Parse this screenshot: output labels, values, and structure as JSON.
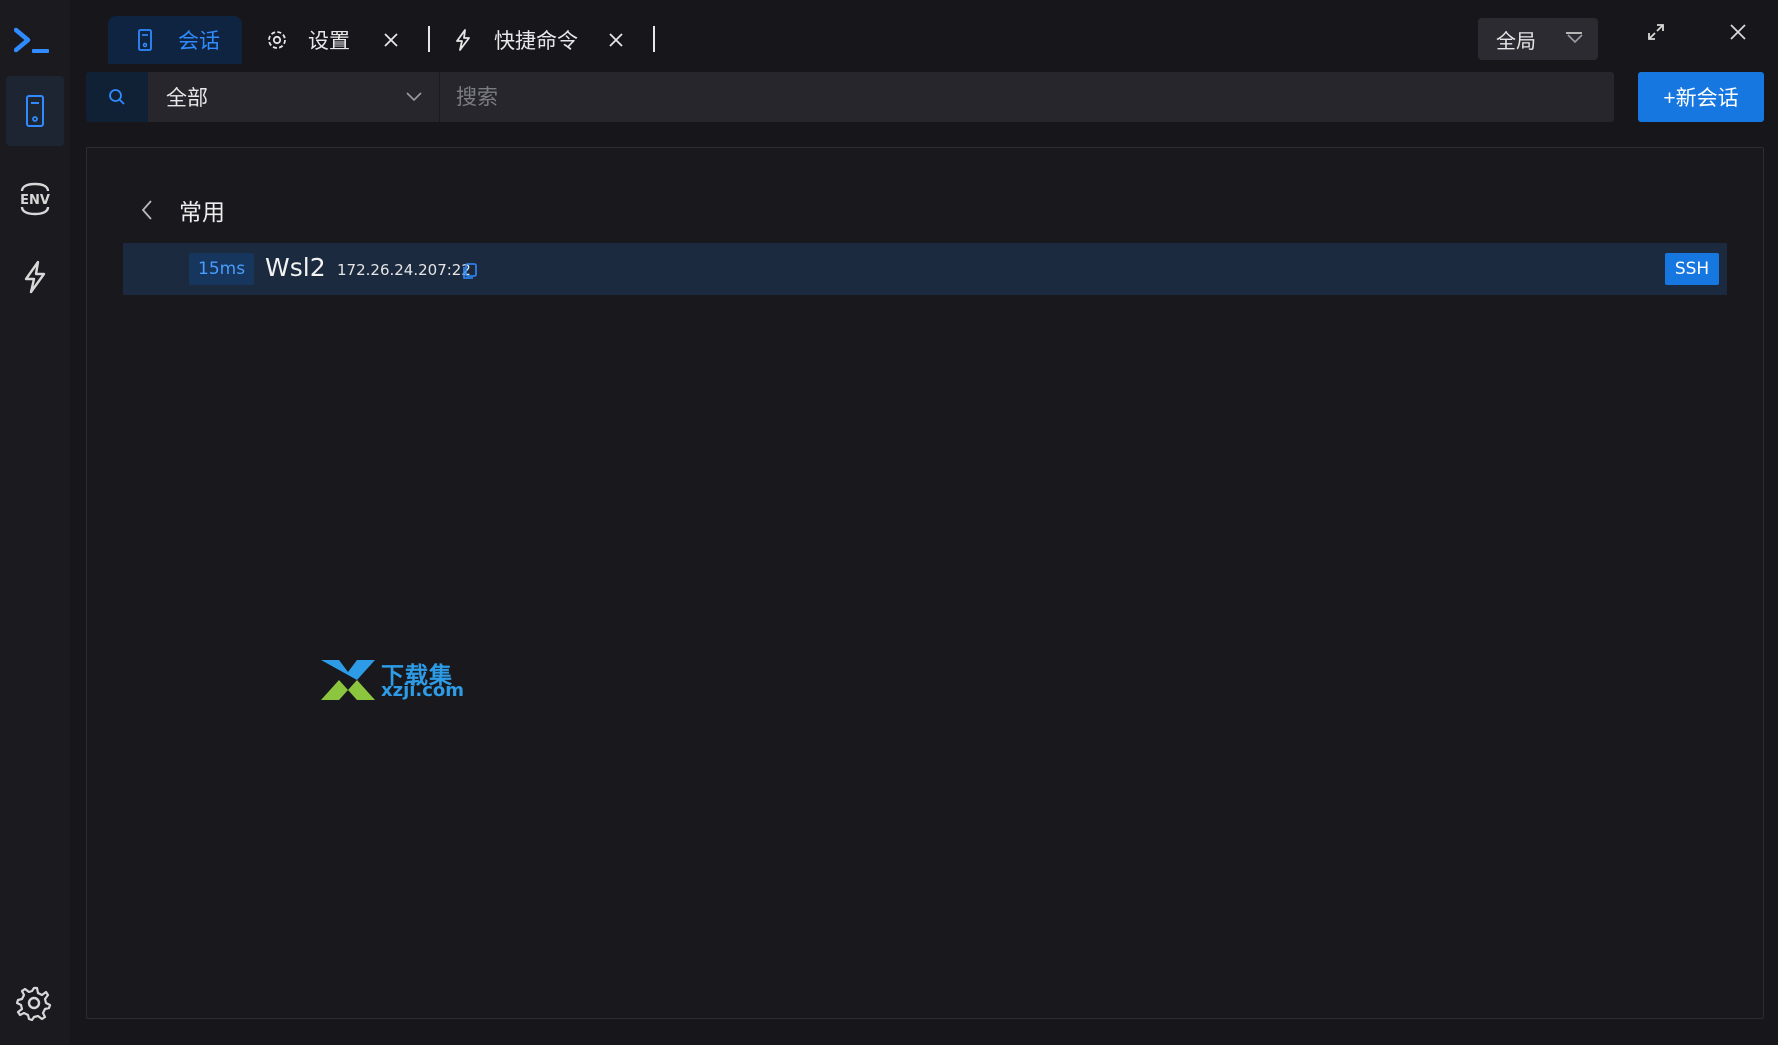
{
  "sidebar": {
    "items": [
      {
        "name": "sessions",
        "icon": "server-icon",
        "active": true
      },
      {
        "name": "env",
        "icon": "env-icon",
        "label": "ENV"
      },
      {
        "name": "quick-commands",
        "icon": "lightning-icon"
      }
    ],
    "settings_icon": "gear-icon"
  },
  "tabs": [
    {
      "label": "会话",
      "icon": "server-icon",
      "active": true
    },
    {
      "label": "设置",
      "icon": "gear-icon",
      "closable": true
    },
    {
      "label": "快捷命令",
      "icon": "lightning-icon",
      "closable": true
    }
  ],
  "scope_select": {
    "value": "全局"
  },
  "window_controls": [
    "minimize-icon",
    "restore-icon",
    "close-icon"
  ],
  "search": {
    "group_filter": "全部",
    "placeholder": "搜索",
    "value": ""
  },
  "new_session_button": "+新会话",
  "group": {
    "title": "常用"
  },
  "sessions": [
    {
      "latency": "15ms",
      "name": "Wsl2",
      "host": "172.26.24.207:22",
      "protocol": "SSH"
    }
  ],
  "watermark": {
    "cn": "下载集",
    "en": "xzji.com"
  },
  "colors": {
    "accent": "#1677e0",
    "accent_text": "#2f8bff",
    "background": "#16161b",
    "row_highlight": "#1b2a3f"
  }
}
